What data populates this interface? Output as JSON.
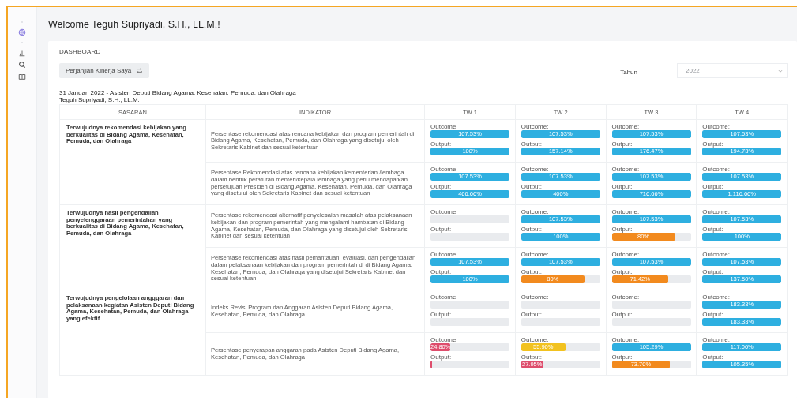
{
  "header": {
    "title": "Welcome Teguh Supriyadi, S.H., LL.M.!"
  },
  "sidebar": {
    "items": [
      {
        "kind": "dot"
      },
      {
        "kind": "globe"
      },
      {
        "kind": "dot"
      },
      {
        "kind": "chart"
      },
      {
        "kind": "search"
      },
      {
        "kind": "book"
      }
    ]
  },
  "dashboard": {
    "heading": "DASHBOARD",
    "button": "Perjanjian Kinerja Saya",
    "year_label": "Tahun",
    "year_value": "2022",
    "subtitle": "31 Januari 2022 - Asisten Deputi Bidang Agama, Kesehatan, Pemuda, dan Olahraga",
    "person": "Teguh Supriyadi, S.H., LL.M."
  },
  "table": {
    "columns": [
      "SASARAN",
      "INDIKATOR",
      "TW 1",
      "TW 2",
      "TW 3",
      "TW 4"
    ],
    "groups": [
      {
        "sasaran": "Terwujudnya rekomendasi kebijakan yang berkualitas di Bidang Agama, Kesehatan, Pemuda, dan Olahraga",
        "indikators": [
          {
            "text": "Persentase rekomendasi atas rencana kebijakan dan program pemerintah di Bidang Agama, Kesehatan, Pemuda, dan Olahraga yang disetujui oleh Sekretaris Kabinet dan sesuai ketentuan",
            "tw": [
              {
                "outcome": {
                  "label": "Outcome:",
                  "level": 1,
                  "reading": "107.53%",
                  "color": "#2eafe0"
                },
                "output": {
                  "label": "Output:",
                  "level": 1,
                  "reading": "100%",
                  "color": "#2eafe0"
                }
              },
              {
                "outcome": {
                  "label": "Outcome:",
                  "level": 1,
                  "reading": "107.53%",
                  "color": "#2eafe0"
                },
                "output": {
                  "label": "Output:",
                  "level": 1,
                  "reading": "157.14%",
                  "color": "#2eafe0"
                }
              },
              {
                "outcome": {
                  "label": "Outcome:",
                  "level": 1,
                  "reading": "107.53%",
                  "color": "#2eafe0"
                },
                "output": {
                  "label": "Output:",
                  "level": 1,
                  "reading": "176.47%",
                  "color": "#2eafe0"
                }
              },
              {
                "outcome": {
                  "label": "Outcome:",
                  "level": 1,
                  "reading": "107.53%",
                  "color": "#2eafe0"
                },
                "output": {
                  "label": "Output:",
                  "level": 1,
                  "reading": "194.73%",
                  "color": "#2eafe0"
                }
              }
            ]
          },
          {
            "text": "Persentase Rekomendasi atas rencana kebijakan kementerian /lembaga dalam bentuk peraturan menteri/kepala lembaga yang perlu mendapatkan persetujuan Presiden di Bidang Agama, Kesehatan, Pemuda, dan Olahraga yang disetujui oleh Sekretaris Kabinet dan sesuai ketentuan",
            "tw": [
              {
                "outcome": {
                  "label": "Outcome:",
                  "level": 1,
                  "reading": "107.53%",
                  "color": "#2eafe0"
                },
                "output": {
                  "label": "Output:",
                  "level": 1,
                  "reading": "466.66%",
                  "color": "#2eafe0"
                }
              },
              {
                "outcome": {
                  "label": "Outcome:",
                  "level": 1,
                  "reading": "107.53%",
                  "color": "#2eafe0"
                },
                "output": {
                  "label": "Output:",
                  "level": 1,
                  "reading": "400%",
                  "color": "#2eafe0"
                }
              },
              {
                "outcome": {
                  "label": "Outcome:",
                  "level": 1,
                  "reading": "107.53%",
                  "color": "#2eafe0"
                },
                "output": {
                  "label": "Output:",
                  "level": 1,
                  "reading": "716.66%",
                  "color": "#2eafe0"
                }
              },
              {
                "outcome": {
                  "label": "Outcome:",
                  "level": 1,
                  "reading": "107.53%",
                  "color": "#2eafe0"
                },
                "output": {
                  "label": "Output:",
                  "level": 1,
                  "reading": "1,116.66%",
                  "color": "#2eafe0"
                }
              }
            ]
          }
        ]
      },
      {
        "sasaran": "Terwujudnya hasil pengendalian penyelenggaraan pemerintahan yang berkualitas di Bidang Agama, Kesehatan, Pemuda, dan Olahraga",
        "indikators": [
          {
            "text": "Persentase rekomendasi alternatif penyelesaian masalah atas pelaksanaan kebijakan dan program pemerintah yang mengalami hambatan di Bidang Agama, Kesehatan, Pemuda, dan Olahraga yang disetujui oleh Sekretaris Kabinet dan sesuai ketentuan",
            "tw": [
              {
                "outcome": {
                  "label": "Outcome:"
                },
                "output": {
                  "label": "Output:"
                }
              },
              {
                "outcome": {
                  "label": "Outcome:",
                  "level": 1,
                  "reading": "107.53%",
                  "color": "#2eafe0"
                },
                "output": {
                  "label": "Output:",
                  "level": 1,
                  "reading": "100%",
                  "color": "#2eafe0"
                }
              },
              {
                "outcome": {
                  "label": "Outcome:",
                  "level": 1,
                  "reading": "107.53%",
                  "color": "#2eafe0"
                },
                "output": {
                  "label": "Output:",
                  "level": 0.8,
                  "reading": "80%",
                  "color": "#f28a1e"
                }
              },
              {
                "outcome": {
                  "label": "Outcome:",
                  "level": 1,
                  "reading": "107.53%",
                  "color": "#2eafe0"
                },
                "output": {
                  "label": "Output:",
                  "level": 1,
                  "reading": "100%",
                  "color": "#2eafe0"
                }
              }
            ]
          },
          {
            "text": "Persentase rekomendasi atas hasil pemantauan, evaluasi, dan pengendalian dalam pelaksanaan kebijakan dan program pemerintah di di Bidang Agama, Kesehatan, Pemuda, dan Olahraga yang disetujui Sekretaris Kabinet dan sesuai ketentuan",
            "tw": [
              {
                "outcome": {
                  "label": "Outcome:",
                  "level": 1,
                  "reading": "107.53%",
                  "color": "#2eafe0"
                },
                "output": {
                  "label": "Output:",
                  "level": 1,
                  "reading": "100%",
                  "color": "#2eafe0"
                }
              },
              {
                "outcome": {
                  "label": "Outcome:",
                  "level": 1,
                  "reading": "107.53%",
                  "color": "#2eafe0"
                },
                "output": {
                  "label": "Output:",
                  "level": 0.8,
                  "reading": "80%",
                  "color": "#f28a1e"
                }
              },
              {
                "outcome": {
                  "label": "Outcome:",
                  "level": 1,
                  "reading": "107.53%",
                  "color": "#2eafe0"
                },
                "output": {
                  "label": "Output:",
                  "level": 0.7142,
                  "reading": "71.42%",
                  "color": "#f28a1e"
                }
              },
              {
                "outcome": {
                  "label": "Outcome:",
                  "level": 1,
                  "reading": "107.53%",
                  "color": "#2eafe0"
                },
                "output": {
                  "label": "Output:",
                  "level": 1,
                  "reading": "137.50%",
                  "color": "#2eafe0"
                }
              }
            ]
          }
        ]
      },
      {
        "sasaran": "Terwujudnya pengelolaan angggaran dan pelaksanaan kegiatan Asisten Deputi Bidang Agama, Kesehatan, Pemuda, dan Olahraga yang efektif",
        "indikators": [
          {
            "text": "Indeks Revisi Program dan Anggaran Asisten Deputi Bidang Agama, Kesehatan, Pemuda, dan Olahraga",
            "tw": [
              {
                "outcome": {
                  "label": "Outcome:"
                },
                "output": {
                  "label": "Output:"
                }
              },
              {
                "outcome": {
                  "label": "Outcome:"
                },
                "output": {
                  "label": "Output:"
                }
              },
              {
                "outcome": {
                  "label": "Outcome:"
                },
                "output": {
                  "label": "Output:"
                }
              },
              {
                "outcome": {
                  "label": "Outcome:",
                  "level": 1,
                  "reading": "183.33%",
                  "color": "#2eafe0"
                },
                "output": {
                  "label": "Output:",
                  "level": 1,
                  "reading": "183.33%",
                  "color": "#2eafe0"
                }
              }
            ]
          },
          {
            "text": "Persentase penyerapan anggaran pada Asisten Deputi Bidang Agama, Kesehatan, Pemuda, dan Olahraga",
            "tw": [
              {
                "outcome": {
                  "label": "Outcome:",
                  "level": 0.248,
                  "reading": "24.80%",
                  "color": "#de4d6c"
                },
                "output": {
                  "label": "Output:",
                  "level": 0.02,
                  "color": "#de4d6c"
                }
              },
              {
                "outcome": {
                  "label": "Outcome:",
                  "level": 0.559,
                  "reading": "55.90%",
                  "color": "#f2c21f"
                },
                "output": {
                  "label": "Output:",
                  "level": 0.2795,
                  "reading": "27.95%",
                  "color": "#de4d6c"
                }
              },
              {
                "outcome": {
                  "label": "Outcome:",
                  "level": 1,
                  "reading": "105.29%",
                  "color": "#2eafe0"
                },
                "output": {
                  "label": "Output:",
                  "level": 0.737,
                  "reading": "73.70%",
                  "color": "#f28a1e"
                }
              },
              {
                "outcome": {
                  "label": "Outcome:",
                  "level": 1,
                  "reading": "117.06%",
                  "color": "#2eafe0"
                },
                "output": {
                  "label": "Output:",
                  "level": 1,
                  "reading": "105.35%",
                  "color": "#2eafe0"
                }
              }
            ]
          }
        ]
      }
    ]
  }
}
